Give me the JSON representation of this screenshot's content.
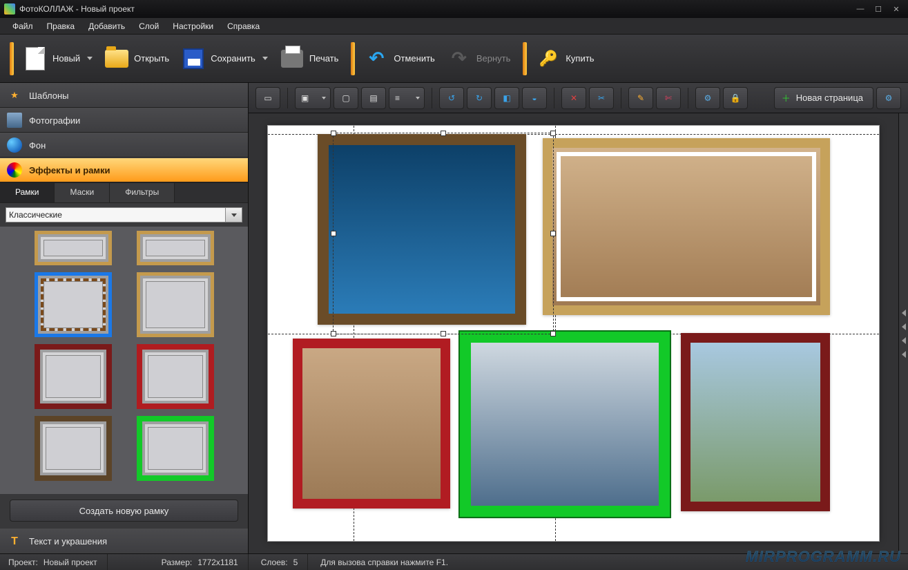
{
  "title": "ФотоКОЛЛАЖ - Новый проект",
  "menu": {
    "file": "Файл",
    "edit": "Правка",
    "add": "Добавить",
    "layer": "Слой",
    "settings": "Настройки",
    "help": "Справка"
  },
  "toolbar": {
    "new": "Новый",
    "open": "Открыть",
    "save": "Сохранить",
    "print": "Печать",
    "undo": "Отменить",
    "redo": "Вернуть",
    "buy": "Купить"
  },
  "canvas_toolbar": {
    "new_page": "Новая страница"
  },
  "sidebar": {
    "templates": "Шаблоны",
    "photos": "Фотографии",
    "background": "Фон",
    "effects": "Эффекты и рамки",
    "text_decor": "Текст и украшения"
  },
  "subtabs": {
    "frames": "Рамки",
    "masks": "Маски",
    "filters": "Фильтры"
  },
  "category": "Классические",
  "create_frame": "Создать новую рамку",
  "status": {
    "project_label": "Проект:",
    "project_value": "Новый проект",
    "size_label": "Размер:",
    "size_value": "1772x1181",
    "layers_label": "Слоев:",
    "layers_value": "5",
    "help": "Для вызова справки нажмите F1."
  },
  "watermark": "MIRPROGRAMM.RU"
}
